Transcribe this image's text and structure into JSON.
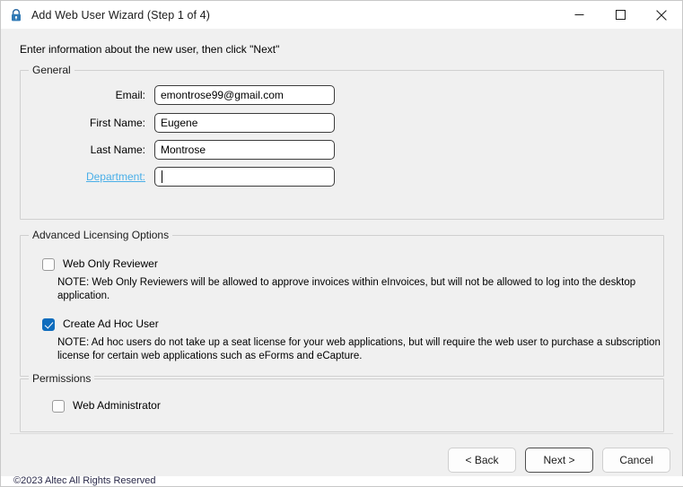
{
  "window": {
    "title": "Add Web User Wizard (Step 1 of 4)",
    "icon": "lock-icon",
    "controls": {
      "minimize": "minimize-icon",
      "maximize": "maximize-icon",
      "close": "close-icon"
    }
  },
  "instruction": "Enter information about the new user, then click \"Next\"",
  "general": {
    "legend": "General",
    "fields": [
      {
        "label": "Email:",
        "value": "emontrose99@gmail.com",
        "placeholder": "",
        "focused": false
      },
      {
        "label": "First Name:",
        "value": "Eugene",
        "placeholder": "",
        "focused": false
      },
      {
        "label": "Last Name:",
        "value": "Montrose",
        "placeholder": "",
        "focused": false
      },
      {
        "label": "Department:",
        "value": "",
        "placeholder": "",
        "focused": true
      }
    ]
  },
  "licensing": {
    "legend": "Advanced Licensing Options",
    "web_only_reviewer": {
      "label": "Web Only Reviewer",
      "checked": false,
      "note": "NOTE: Web Only Reviewers will be allowed to approve invoices within eInvoices, but will not be allowed to log into the desktop application."
    },
    "create_ad_hoc_user": {
      "label": "Create Ad Hoc User",
      "checked": true,
      "note": "NOTE: Ad hoc users do not take up a seat license for your web applications, but will require the web user to purchase a subscription license for certain web applications such as eForms and eCapture."
    }
  },
  "permissions": {
    "legend": "Permissions",
    "web_administrator": {
      "label": "Web Administrator",
      "checked": false
    }
  },
  "footer": {
    "back_label": "< Back",
    "next_label": "Next >",
    "cancel_label": "Cancel"
  },
  "status_strip": {
    "text": "©2023 Altec All Rights Reserved"
  },
  "colors": {
    "accent": "#0f6cbd",
    "link": "#4aafe8",
    "window_bg": "#f0f0f0",
    "titlebar_bg": "#ffffff"
  }
}
